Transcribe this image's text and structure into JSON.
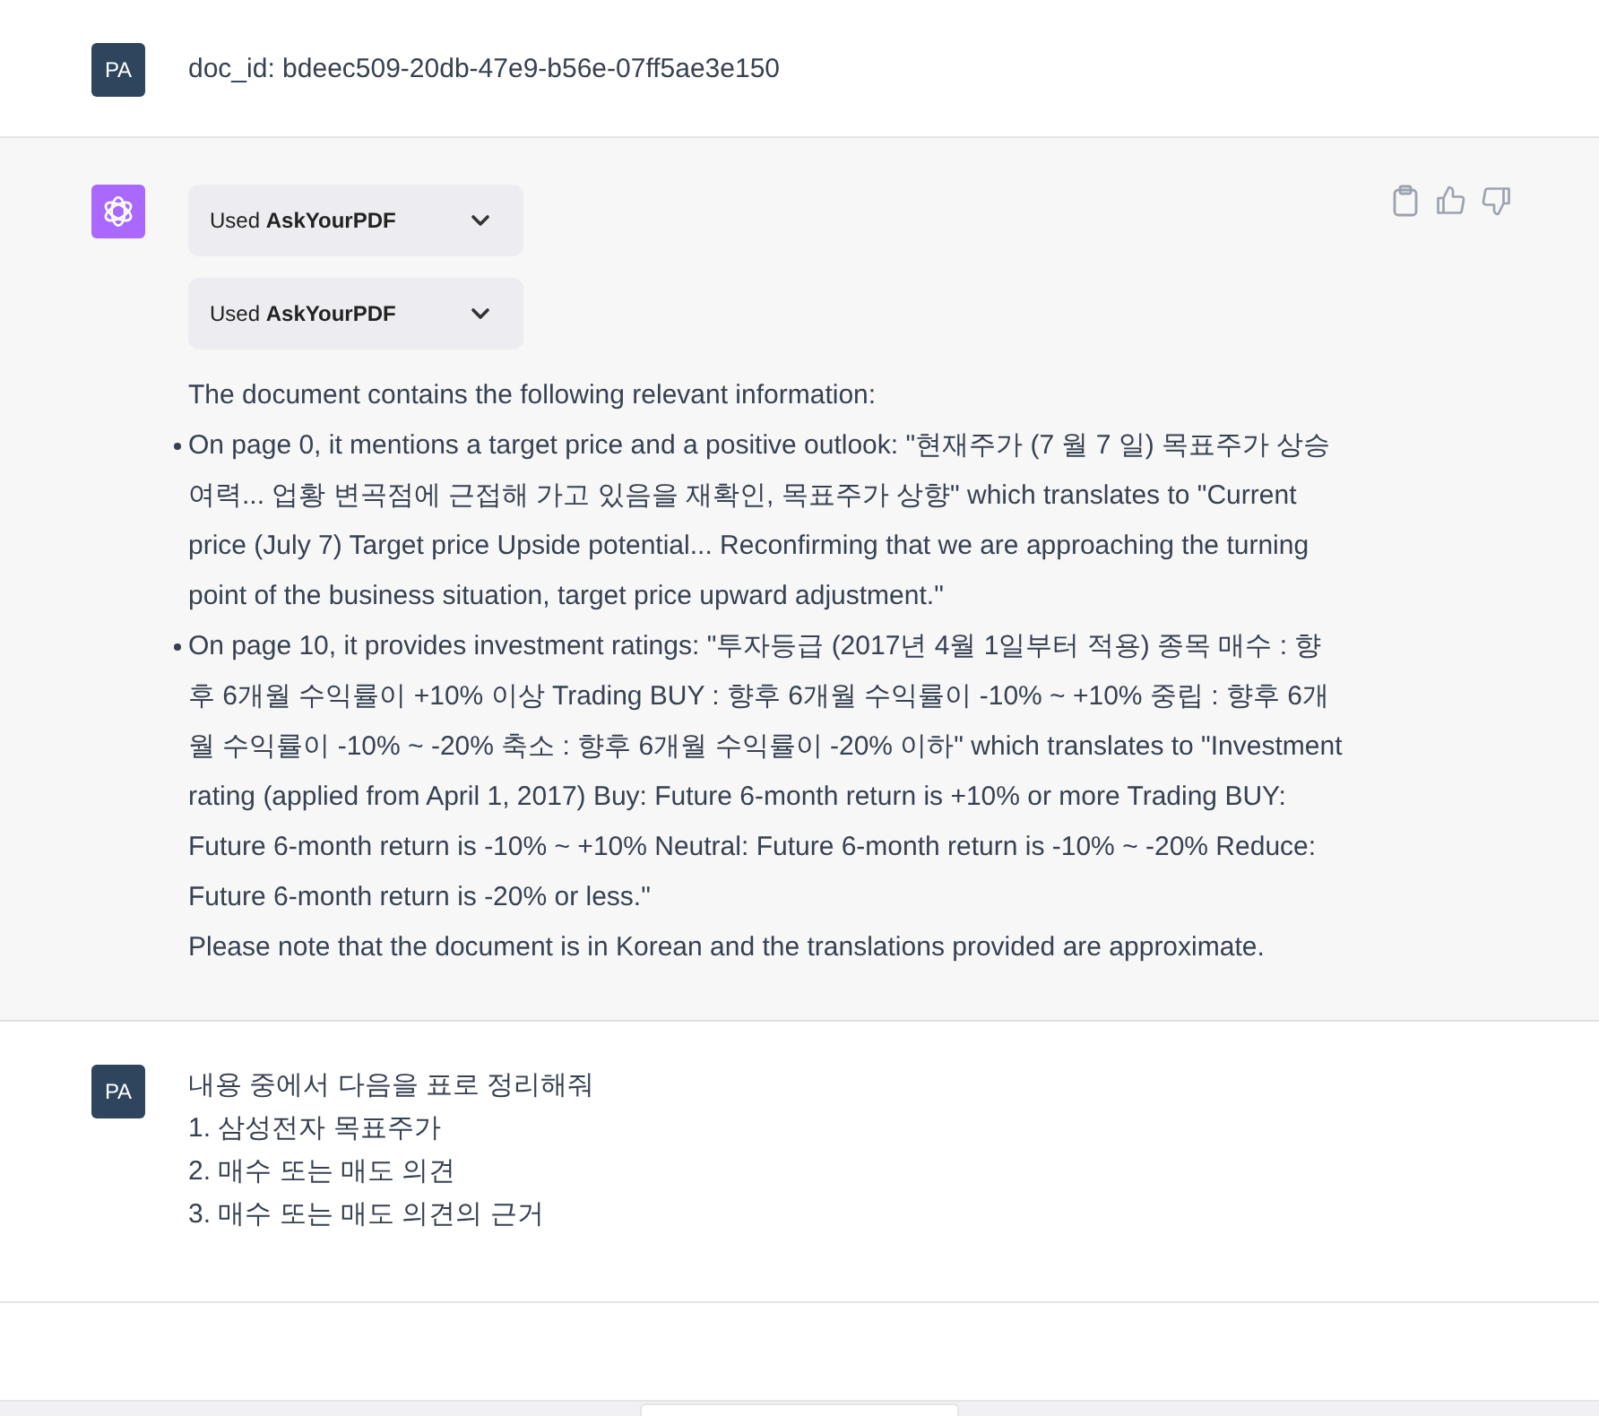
{
  "messages": [
    {
      "kind": "user",
      "avatar": "PA",
      "lines": [
        "doc_id: bdeec509-20db-47e9-b56e-07ff5ae3e150"
      ]
    },
    {
      "kind": "assistant",
      "tools": [
        {
          "prefix": "Used",
          "name": "AskYourPDF",
          "expanded": false
        },
        {
          "prefix": "Used",
          "name": "AskYourPDF",
          "expanded": false
        }
      ],
      "intro": "The document contains the following relevant information:",
      "bullets": [
        "On page 0, it mentions a target price and a positive outlook: \"현재주가 (7 월 7 일) 목표주가 상승여력... 업황 변곡점에 근접해 가고 있음을 재확인, 목표주가 상향\" which translates to \"Current price (July 7) Target price Upside potential... Reconfirming that we are approaching the turning point of the business situation, target price upward adjustment.\"",
        "On page 10, it provides investment ratings: \"투자등급 (2017년 4월 1일부터 적용) 종목 매수 : 향후 6개월 수익률이 +10% 이상 Trading BUY : 향후 6개월 수익률이 -10% ~ +10% 중립 : 향후 6개월 수익률이 -10% ~ -20% 축소 : 향후 6개월 수익률이 -20% 이하\" which translates to \"Investment rating (applied from April 1, 2017) Buy: Future 6-month return is +10% or more Trading BUY: Future 6-month return is -10% ~ +10% Neutral: Future 6-month return is -10% ~ -20% Reduce: Future 6-month return is -20% or less.\""
      ],
      "outro": "Please note that the document is in Korean and the translations provided are approximate."
    },
    {
      "kind": "user",
      "avatar": "PA",
      "lines": [
        "내용 중에서 다음을 표로 정리해줘",
        "1. 삼성전자 목표주가",
        "2. 매수 또는 매도 의견",
        "3. 매수 또는 매도 의견의 근거"
      ]
    }
  ]
}
